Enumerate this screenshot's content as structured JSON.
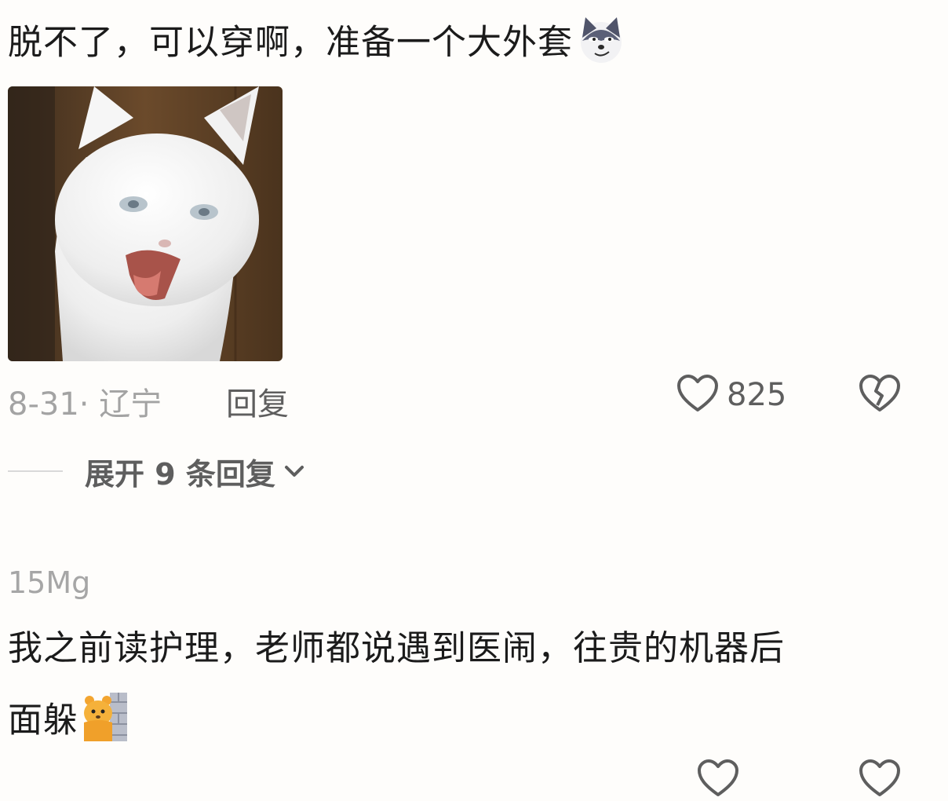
{
  "comment1": {
    "text": "脱不了，可以穿啊，准备一个大外套",
    "emoji": "wolf-face-emoji",
    "image": "white-cat-meme",
    "date": "8-31",
    "separator": "·",
    "location": "辽宁",
    "reply_label": "回复",
    "likes": "825",
    "expand_label": "展开 9 条回复"
  },
  "comment2": {
    "username": "15Mg",
    "text_line1": "我之前读护理，老师都说遇到医闹，往贵的机器后",
    "text_line2": "面躲",
    "emoji": "hiding-bear-emoji"
  },
  "colors": {
    "background": "#fefdfb",
    "text_primary": "#1b1b1b",
    "text_muted": "#a3a3a3",
    "text_secondary": "#5e5e5e"
  }
}
